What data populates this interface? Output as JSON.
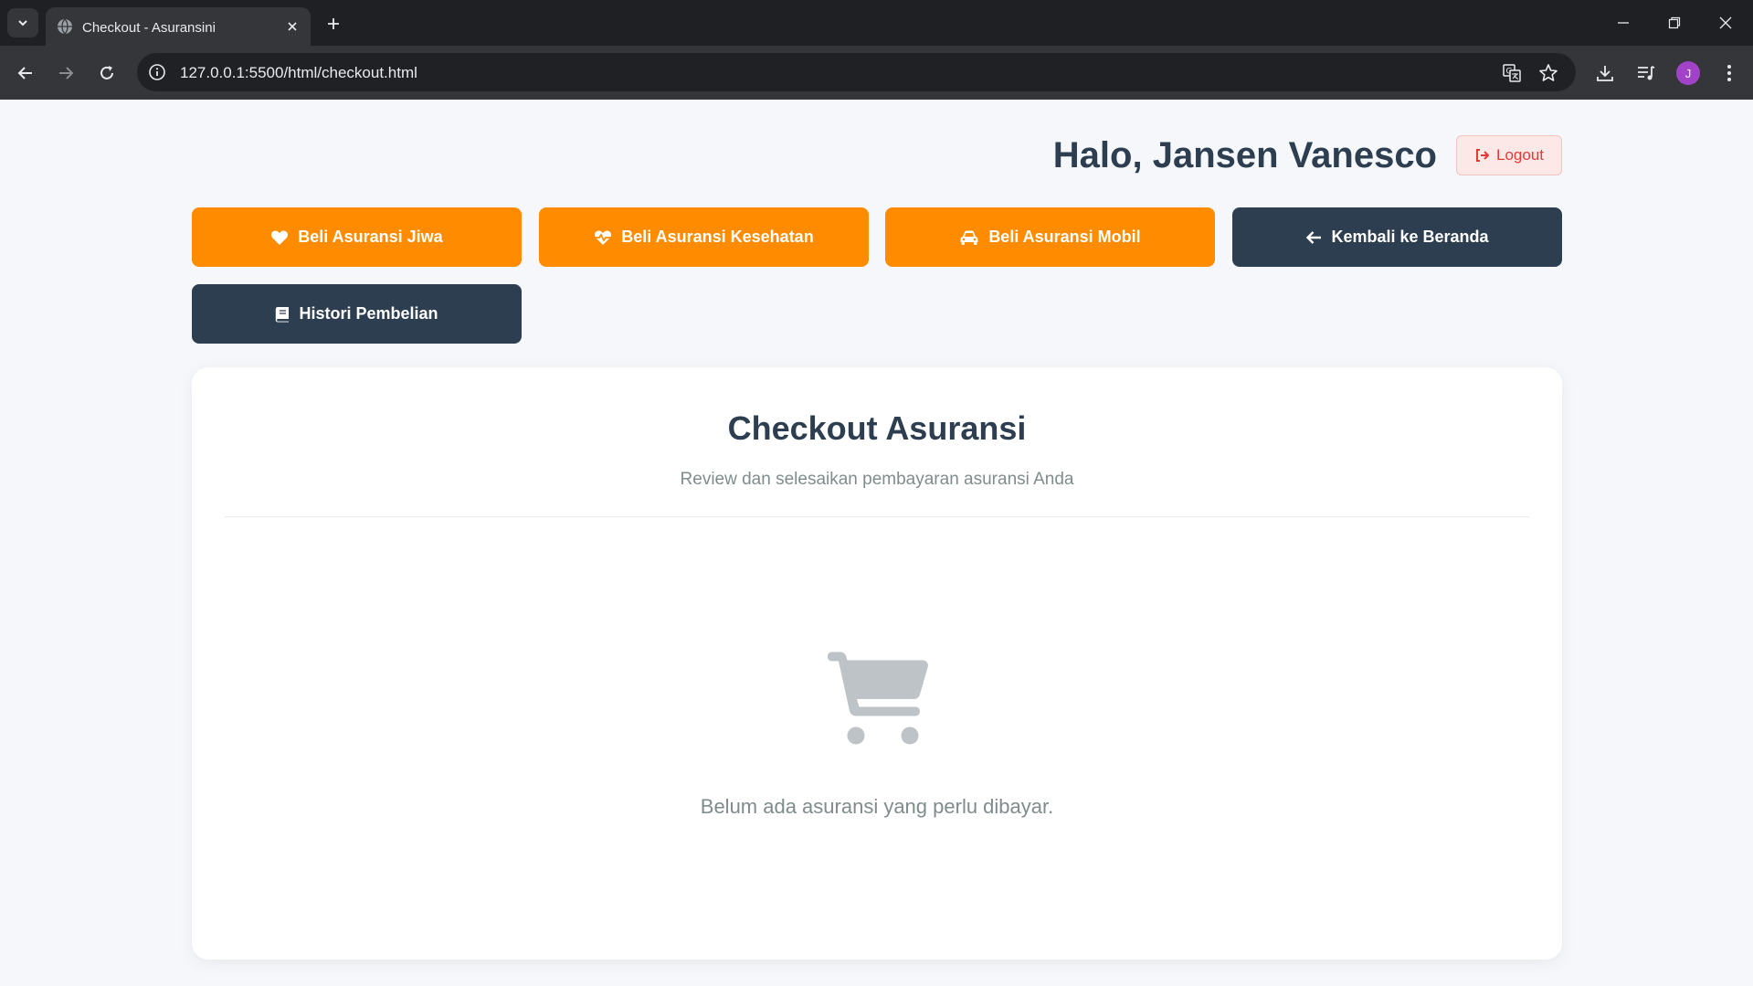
{
  "browser": {
    "tab_title": "Checkout - Asuransini",
    "url": "127.0.0.1:5500/html/checkout.html",
    "profile_initial": "J"
  },
  "header": {
    "greeting": "Halo, Jansen Vanesco",
    "logout_label": "Logout"
  },
  "nav": {
    "items": [
      {
        "label": "Beli Asuransi Jiwa",
        "icon": "heart-icon",
        "color": "#ff8c00"
      },
      {
        "label": "Beli Asuransi Kesehatan",
        "icon": "heart-pulse-icon",
        "color": "#ff8c00"
      },
      {
        "label": "Beli Asuransi Mobil",
        "icon": "car-icon",
        "color": "#ff8c00"
      },
      {
        "label": "Kembali ke Beranda",
        "icon": "arrow-left-icon",
        "color": "#2c3e50"
      },
      {
        "label": "Histori Pembelian",
        "icon": "book-icon",
        "color": "#2c3e50"
      }
    ]
  },
  "checkout": {
    "title": "Checkout Asuransi",
    "subtitle": "Review dan selesaikan pembayaran asuransi Anda",
    "empty_icon": "shopping-cart-icon",
    "empty_message": "Belum ada asuransi yang perlu dibayar."
  },
  "colors": {
    "accent_orange": "#ff8c00",
    "navy": "#2c3e50",
    "logout_red": "#e53935"
  }
}
